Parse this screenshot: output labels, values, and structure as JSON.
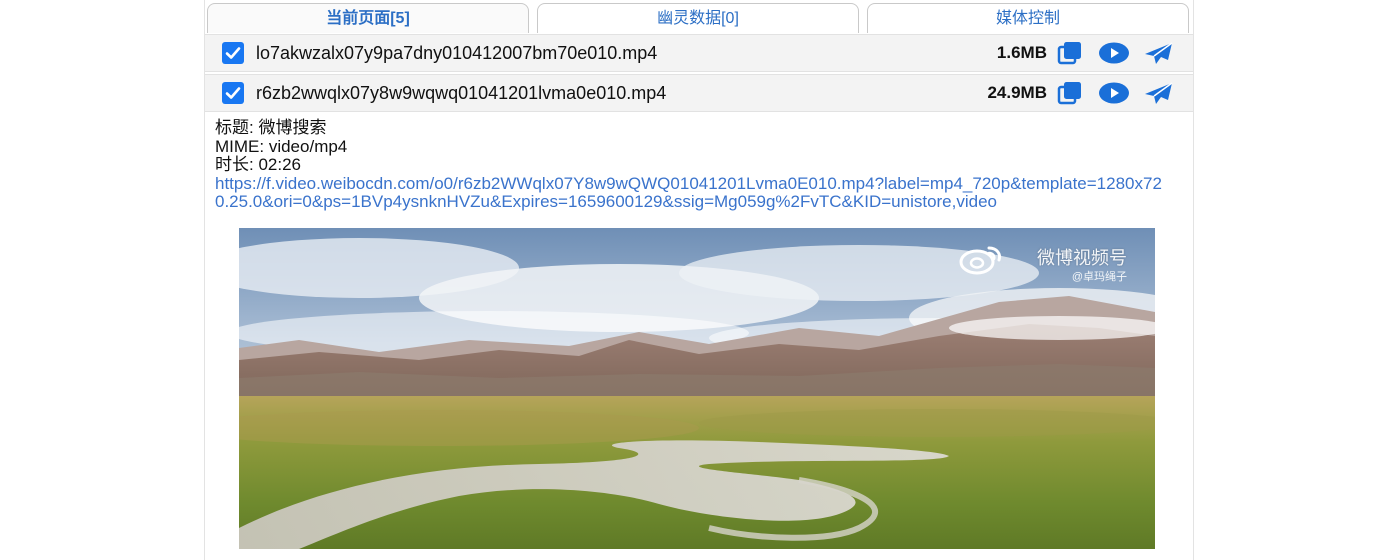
{
  "tabs": [
    {
      "label": "当前页面[5]",
      "active": true
    },
    {
      "label": "幽灵数据[0]",
      "active": false
    },
    {
      "label": "媒体控制",
      "active": false
    }
  ],
  "files": [
    {
      "name": "lo7akwzalx07y9pa7dny010412007bm70e010.mp4",
      "size": "1.6MB",
      "checked": true
    },
    {
      "name": "r6zb2wwqlx07y8w9wqwq01041201lvma0e010.mp4",
      "size": "24.9MB",
      "checked": true
    }
  ],
  "details": {
    "title_line": "标题: 微博搜索",
    "mime_line": "MIME: video/mp4",
    "duration_line": "时长: 02:26",
    "url": "https://f.video.weibocdn.com/o0/r6zb2WWqlx07Y8w9wQWQ01041201Lvma0E010.mp4?label=mp4_720p&template=1280x720.25.0&ori=0&ps=1BVp4ysnknHVZu&Expires=1659600129&ssig=Mg059g%2FvTC&KID=unistore,video"
  },
  "video": {
    "watermark": "微博视频号",
    "watermark_sub": "@卓玛绳子"
  },
  "icons": {
    "checkbox": "checkmark-icon",
    "copy": "copy-icon",
    "play": "play-icon",
    "send": "send-icon"
  },
  "colors": {
    "accent": "#1877f2",
    "link": "#3a73cc",
    "tab_text": "#2c6fc5",
    "row_bg": "#f3f3f3"
  }
}
